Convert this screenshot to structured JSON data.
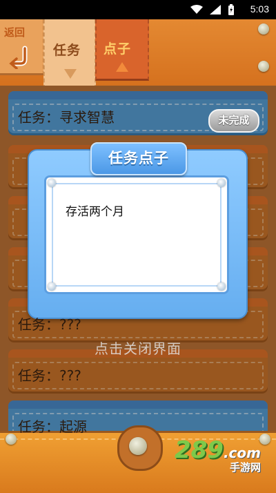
{
  "status": {
    "time": "5:03"
  },
  "tabs": {
    "back": "返回",
    "task": "任务",
    "idea": "点子"
  },
  "tasks": [
    {
      "label": "任务：寻求智慧",
      "badge": "未完成",
      "color": "#5aa4db"
    },
    {
      "label": "任务：???",
      "color": "#d5792b"
    },
    {
      "label": "任务：???",
      "color": "#d5792b"
    },
    {
      "label": "任务：起源",
      "color": "#5aa4db"
    }
  ],
  "dialog": {
    "title": "任务点子",
    "text": "存活两个月"
  },
  "close_hint": "点击关闭界面",
  "watermark": {
    "num": "289",
    "domain": ".com",
    "sub": "手游网"
  }
}
